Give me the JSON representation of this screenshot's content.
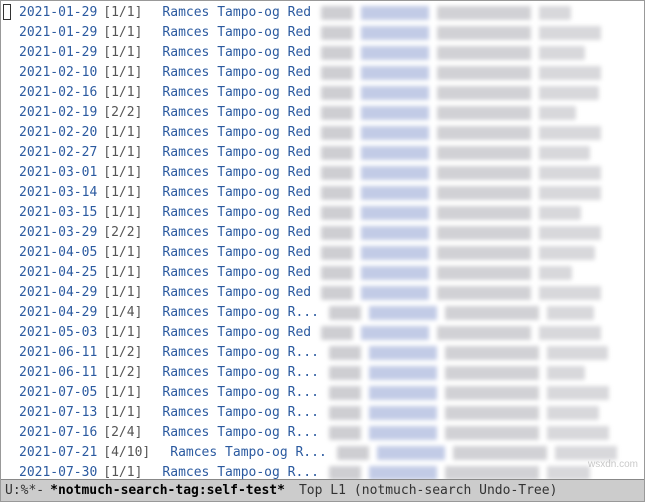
{
  "results": [
    {
      "date": "2021-01-29",
      "count": "[1/1]",
      "author": "Ramces Tampo-og Red",
      "cursor": true
    },
    {
      "date": "2021-01-29",
      "count": "[1/1]",
      "author": "Ramces Tampo-og Red"
    },
    {
      "date": "2021-01-29",
      "count": "[1/1]",
      "author": "Ramces Tampo-og Red"
    },
    {
      "date": "2021-02-10",
      "count": "[1/1]",
      "author": "Ramces Tampo-og Red"
    },
    {
      "date": "2021-02-16",
      "count": "[1/1]",
      "author": "Ramces Tampo-og Red"
    },
    {
      "date": "2021-02-19",
      "count": "[2/2]",
      "author": "Ramces Tampo-og Red"
    },
    {
      "date": "2021-02-20",
      "count": "[1/1]",
      "author": "Ramces Tampo-og Red"
    },
    {
      "date": "2021-02-27",
      "count": "[1/1]",
      "author": "Ramces Tampo-og Red"
    },
    {
      "date": "2021-03-01",
      "count": "[1/1]",
      "author": "Ramces Tampo-og Red"
    },
    {
      "date": "2021-03-14",
      "count": "[1/1]",
      "author": "Ramces Tampo-og Red"
    },
    {
      "date": "2021-03-15",
      "count": "[1/1]",
      "author": "Ramces Tampo-og Red"
    },
    {
      "date": "2021-03-29",
      "count": "[2/2]",
      "author": "Ramces Tampo-og Red"
    },
    {
      "date": "2021-04-05",
      "count": "[1/1]",
      "author": "Ramces Tampo-og Red"
    },
    {
      "date": "2021-04-25",
      "count": "[1/1]",
      "author": "Ramces Tampo-og Red"
    },
    {
      "date": "2021-04-29",
      "count": "[1/1]",
      "author": "Ramces Tampo-og Red"
    },
    {
      "date": "2021-04-29",
      "count": "[1/4]",
      "author": "Ramces Tampo-og R..."
    },
    {
      "date": "2021-05-03",
      "count": "[1/1]",
      "author": "Ramces Tampo-og Red"
    },
    {
      "date": "2021-06-11",
      "count": "[1/2]",
      "author": "Ramces Tampo-og R..."
    },
    {
      "date": "2021-06-11",
      "count": "[1/2]",
      "author": "Ramces Tampo-og R..."
    },
    {
      "date": "2021-07-05",
      "count": "[1/1]",
      "author": "Ramces Tampo-og R..."
    },
    {
      "date": "2021-07-13",
      "count": "[1/1]",
      "author": "Ramces Tampo-og R..."
    },
    {
      "date": "2021-07-16",
      "count": "[2/4]",
      "author": "Ramces Tampo-og R..."
    },
    {
      "date": "2021-07-21",
      "count": "[4/10]",
      "author": "Ramces Tampo-og R..."
    },
    {
      "date": "2021-07-30",
      "count": "[1/1]",
      "author": "Ramces Tampo-og R..."
    }
  ],
  "modeline": {
    "left": "U:%*-",
    "buffer": "*notmuch-search-tag:self-test*",
    "position": "Top L1",
    "minor": "(notmuch-search Undo-Tree)"
  },
  "watermark": "wsxdn.com"
}
